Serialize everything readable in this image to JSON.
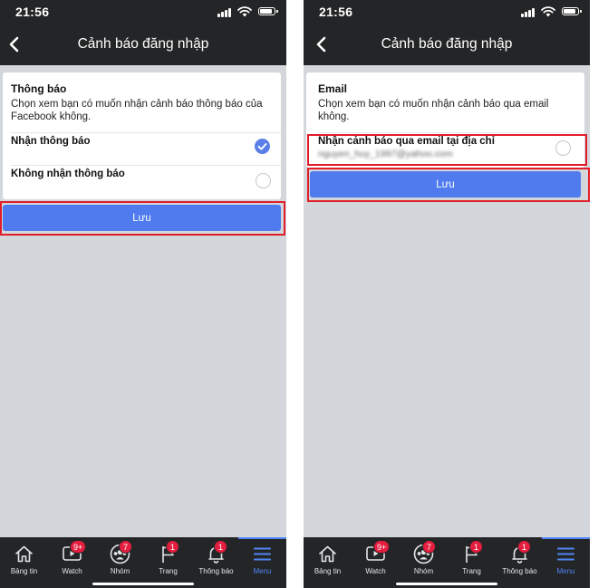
{
  "left": {
    "status": {
      "time": "21:56"
    },
    "header": {
      "title": "Cảnh báo đăng nhập"
    },
    "section": {
      "title": "Thông báo",
      "description": "Chọn xem bạn có muốn nhận cảnh báo thông báo của Facebook không."
    },
    "options": [
      {
        "label": "Nhận thông báo",
        "selected": true
      },
      {
        "label": "Không nhận thông báo",
        "selected": false
      }
    ],
    "save_label": "Lưu"
  },
  "right": {
    "status": {
      "time": "21:56"
    },
    "header": {
      "title": "Cảnh báo đăng nhập"
    },
    "section": {
      "title": "Email",
      "description": "Chọn xem bạn có muốn nhận cảnh báo qua email không."
    },
    "options": [
      {
        "label": "Nhận cảnh báo qua email tại địa chỉ",
        "detail": "nguyen_huy_1997@yahoo.com",
        "selected": false
      }
    ],
    "save_label": "Lưu"
  },
  "tabs": [
    {
      "label": "Bảng tin",
      "icon": "home-icon",
      "badge": ""
    },
    {
      "label": "Watch",
      "icon": "watch-icon",
      "badge": "9+"
    },
    {
      "label": "Nhóm",
      "icon": "groups-icon",
      "badge": "7"
    },
    {
      "label": "Trang",
      "icon": "flag-icon",
      "badge": "1"
    },
    {
      "label": "Thông báo",
      "icon": "bell-icon",
      "badge": "1"
    },
    {
      "label": "Menu",
      "icon": "menu-icon",
      "badge": "",
      "active": true
    }
  ],
  "colors": {
    "bar_bg": "#242526",
    "save_button": "#4f7bef",
    "active_tab": "#4f86f7",
    "badge": "#e41e3f",
    "highlight": "#e11d2a",
    "background": "#d3d6db"
  }
}
